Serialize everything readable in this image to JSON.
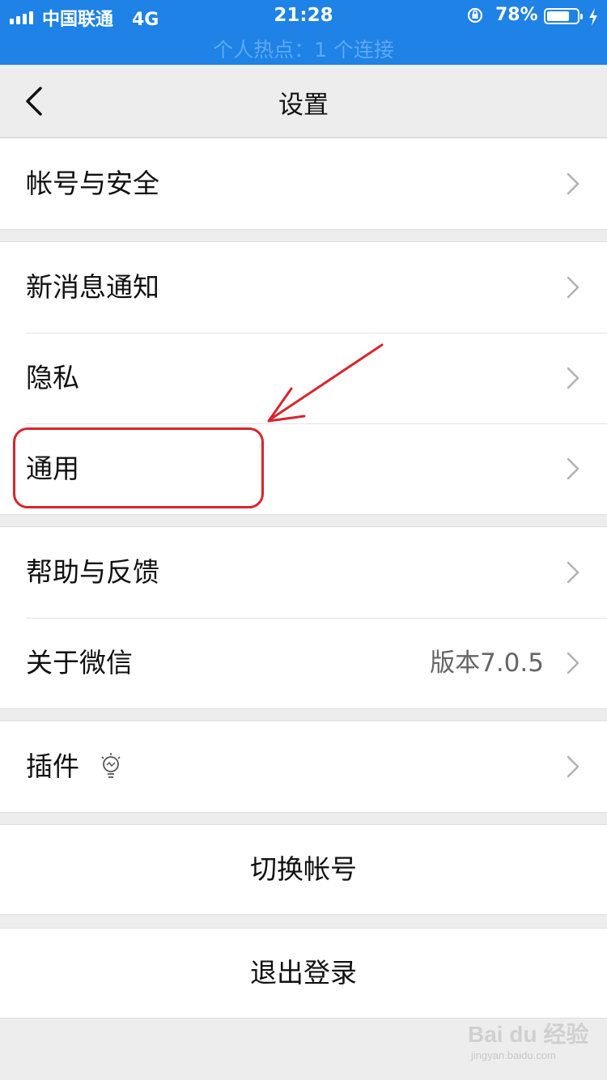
{
  "status_bar": {
    "carrier": "中国联通",
    "network": "4G",
    "time": "21:28",
    "battery_percent_text": "78%",
    "battery_level": 0.78,
    "hotspot_text": "个人热点：1 个连接",
    "bar_color": "#1e82e6"
  },
  "nav": {
    "title": "设置",
    "back_icon": "chevron-left-icon"
  },
  "groups": {
    "account": {
      "items": [
        {
          "label": "帐号与安全"
        }
      ]
    },
    "main": {
      "items": [
        {
          "label": "新消息通知"
        },
        {
          "label": "隐私"
        },
        {
          "label": "通用"
        }
      ]
    },
    "about": {
      "items": [
        {
          "label": "帮助与反馈"
        },
        {
          "label": "关于微信",
          "value": "版本7.0.5"
        }
      ]
    },
    "plugins": {
      "items": [
        {
          "label": "插件",
          "icon": "lightbulb-icon"
        }
      ]
    }
  },
  "actions": {
    "switch_account": "切换帐号",
    "logout": "退出登录"
  },
  "annotation": {
    "color": "#d8252c",
    "highlighted_item": "通用"
  },
  "watermark": {
    "main": "Bai du 经验",
    "sub": "jingyan.baidu.com"
  }
}
